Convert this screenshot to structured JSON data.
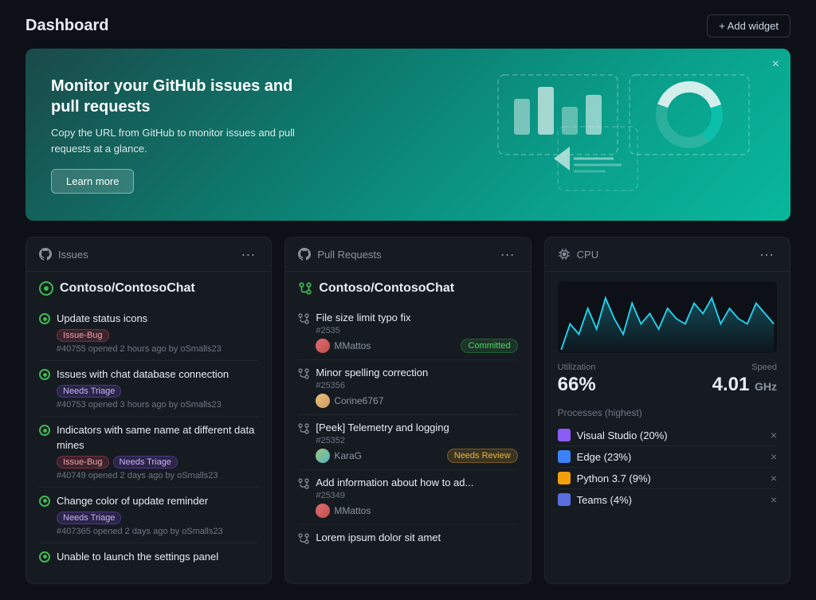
{
  "header": {
    "title": "Dashboard",
    "add_widget_label": "+ Add widget"
  },
  "banner": {
    "title": "Monitor your GitHub issues and pull requests",
    "description": "Copy the URL from GitHub to monitor issues and pull requests at a glance.",
    "learn_more_label": "Learn more"
  },
  "issues_widget": {
    "section_label": "Issues",
    "repo_name": "Contoso/ContosoChat",
    "items": [
      {
        "title": "Update status icons",
        "tags": [
          "Issue-Bug"
        ],
        "meta": "#40755 opened 2 hours ago by oSmalls23"
      },
      {
        "title": "Issues with chat database connection",
        "tags": [
          "Needs Triage"
        ],
        "meta": "#40753 opened 3 hours ago by oSmalls23"
      },
      {
        "title": "Indicators with same name at different data mines",
        "tags": [
          "Issue-Bug",
          "Needs Triage"
        ],
        "meta": "#40749 opened 2 days ago by oSmalls23"
      },
      {
        "title": "Change color of update reminder",
        "tags": [
          "Needs Triage"
        ],
        "meta": "#407365 opened 2 days ago by oSmalls23"
      },
      {
        "title": "Unable to launch the settings panel",
        "tags": [],
        "meta": ""
      }
    ]
  },
  "pr_widget": {
    "section_label": "Pull Requests",
    "repo_name": "Contoso/ContosoChat",
    "items": [
      {
        "title": "File size limit typo fix",
        "number": "#2535",
        "author": "MMattos",
        "avatar_class": "avatar-mm",
        "status": "Committed",
        "status_class": "status-committed"
      },
      {
        "title": "Minor spelling correction",
        "number": "#25356",
        "author": "Corine6767",
        "avatar_class": "avatar-c",
        "status": "",
        "status_class": ""
      },
      {
        "title": "[Peek] Telemetry and logging",
        "number": "#25352",
        "author": "KaraG",
        "avatar_class": "avatar-k",
        "status": "Needs Review",
        "status_class": "status-review"
      },
      {
        "title": "Add information about how to ad...",
        "number": "#25349",
        "author": "MMattos",
        "avatar_class": "avatar-mm",
        "status": "",
        "status_class": ""
      },
      {
        "title": "Lorem ipsum dolor sit amet",
        "number": "",
        "author": "",
        "avatar_class": "",
        "status": "",
        "status_class": ""
      }
    ]
  },
  "cpu_widget": {
    "section_label": "CPU",
    "utilization_label": "Utilization",
    "utilization_value": "66%",
    "speed_label": "Speed",
    "speed_value": "4.01",
    "speed_unit": "GHz",
    "processes_header": "Processes (highest)",
    "processes": [
      {
        "name": "Visual Studio (20%)",
        "icon_color": "#8b5cf6"
      },
      {
        "name": "Edge (23%)",
        "icon_color": "#3b82f6"
      },
      {
        "name": "Python 3.7 (9%)",
        "icon_color": "#f59e0b"
      },
      {
        "name": "Teams (4%)",
        "icon_color": "#5b6ee1"
      }
    ],
    "chart_data": [
      30,
      55,
      45,
      70,
      50,
      80,
      60,
      45,
      75,
      55,
      65,
      50,
      70,
      60,
      55,
      75,
      65,
      80,
      55,
      70,
      60,
      55,
      75,
      65,
      55
    ]
  }
}
